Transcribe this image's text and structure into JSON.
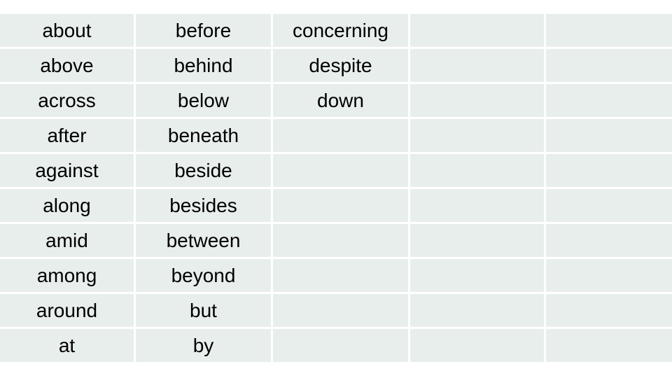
{
  "slide": {
    "background_color": "#ffffff",
    "cell_fill_color": "#e8eeec",
    "gridline_color": "#ffffff",
    "text_color": "#000000"
  },
  "table": {
    "name": "prepositions-table",
    "row_count": 10,
    "column_count": 5,
    "has_header_row": false,
    "rows": [
      [
        "about",
        "before",
        "concerning",
        "",
        ""
      ],
      [
        "above",
        "behind",
        "despite",
        "",
        ""
      ],
      [
        "across",
        "below",
        "down",
        "",
        ""
      ],
      [
        "after",
        "beneath",
        "",
        "",
        ""
      ],
      [
        "against",
        "beside",
        "",
        "",
        ""
      ],
      [
        "along",
        "besides",
        "",
        "",
        ""
      ],
      [
        "amid",
        "between",
        "",
        "",
        ""
      ],
      [
        "among",
        "beyond",
        "",
        "",
        ""
      ],
      [
        "around",
        "but",
        "",
        "",
        ""
      ],
      [
        "at",
        "by",
        "",
        "",
        ""
      ]
    ]
  }
}
